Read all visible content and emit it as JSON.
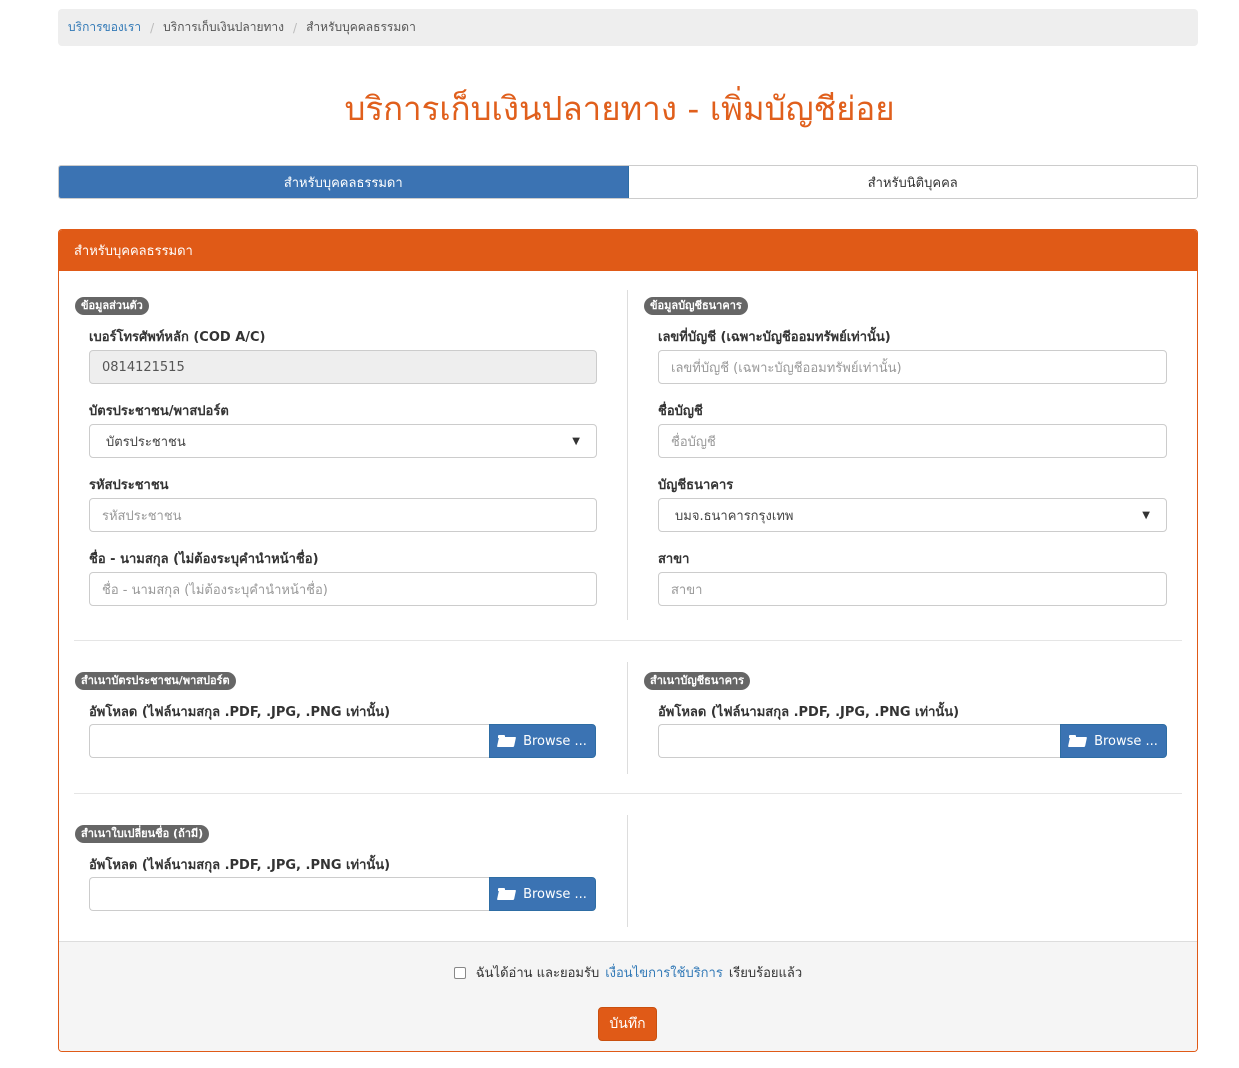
{
  "breadcrumb": {
    "items": [
      "บริการของเรา",
      "บริการเก็บเงินปลายทาง",
      "สำหรับบุคคลธรรมดา"
    ]
  },
  "page_title": "บริการเก็บเงินปลายทาง - เพิ่มบัญชีย่อย",
  "tabs": [
    {
      "label": "สำหรับบุคคลธรรมดา",
      "active": true
    },
    {
      "label": "สำหรับนิติบุคคล",
      "active": false
    }
  ],
  "panel": {
    "heading": "สำหรับบุคคลธรรมดา",
    "personal": {
      "badge": "ข้อมูลส่วนตัว",
      "phone_label": "เบอร์โทรศัพท์หลัก (COD A/C)",
      "phone_value": "0814121515",
      "id_type_label": "บัตรประชาชน/พาสปอร์ต",
      "id_type_value": "บัตรประชาชน",
      "id_number_label": "รหัสประชาชน",
      "id_number_placeholder": "รหัสประชาชน",
      "name_label": "ชื่อ - นามสกุล (ไม่ต้องระบุคำนำหน้าชื่อ)",
      "name_placeholder": "ชื่อ - นามสกุล (ไม่ต้องระบุคำนำหน้าชื่อ)"
    },
    "bank": {
      "badge": "ข้อมูลบัญชีธนาคาร",
      "account_no_label": "เลขที่บัญชี (เฉพาะบัญชีออมทรัพย์เท่านั้น)",
      "account_no_placeholder": "เลขที่บัญชี (เฉพาะบัญชีออมทรัพย์เท่านั้น)",
      "account_name_label": "ชื่อบัญชี",
      "account_name_placeholder": "ชื่อบัญชี",
      "bank_label": "บัญชีธนาคาร",
      "bank_value": "บมจ.ธนาคารกรุงเทพ",
      "branch_label": "สาขา",
      "branch_placeholder": "สาขา"
    },
    "uploads": {
      "id_copy_badge": "สำเนาบัตรประชาชน/พาสปอร์ต",
      "bank_copy_badge": "สำเนาบัญชีธนาคาร",
      "name_change_badge": "สำเนาใบเปลี่ยนชื่อ (ถ้ามี)",
      "upload_label": "อัพโหลด (ไฟล์นามสกุล .PDF, .JPG, .PNG เท่านั้น)",
      "browse_label": "Browse ..."
    },
    "footer": {
      "agree_prefix": "ฉันได้อ่าน และยอมรับ",
      "agree_link": "เงื่อนไขการใช้บริการ",
      "agree_suffix": "เรียบร้อยแล้ว",
      "save_label": "บันทึก"
    }
  },
  "colors": {
    "accent_orange": "#e05a17",
    "primary_blue": "#3b73b3",
    "badge_gray": "#666666"
  }
}
